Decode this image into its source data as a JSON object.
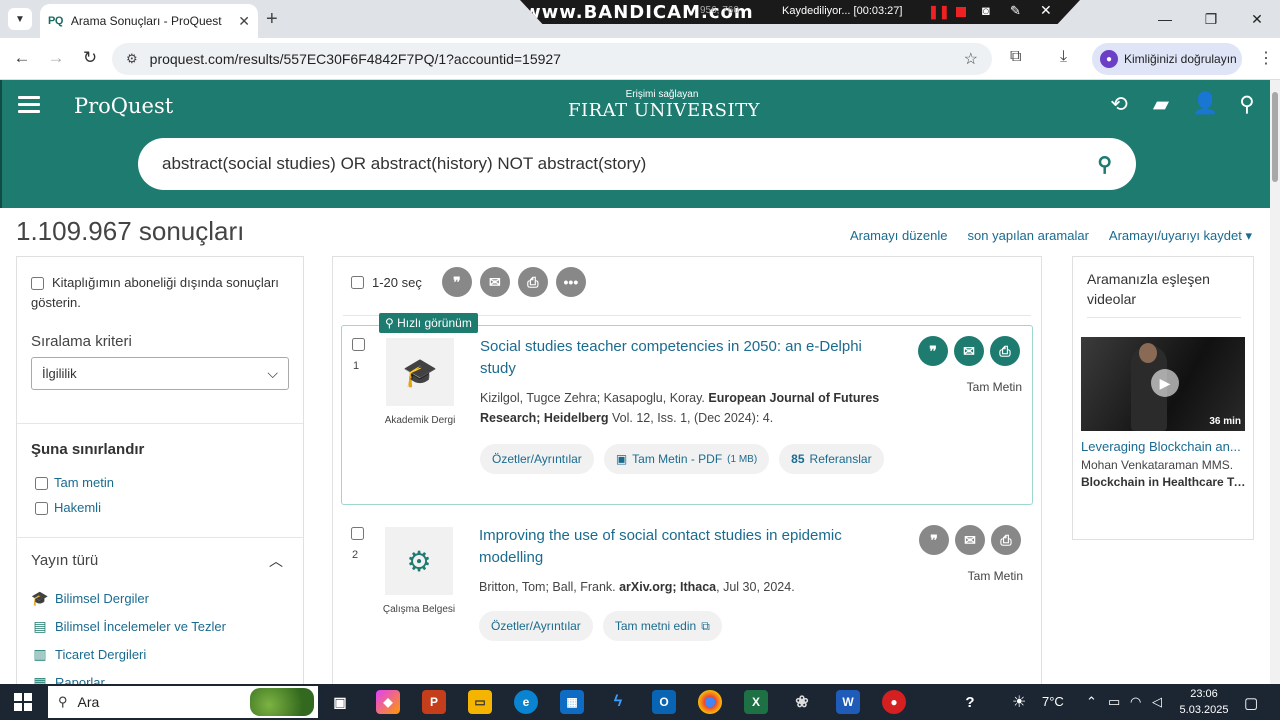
{
  "browser": {
    "tab_favicon": "PQ",
    "tab_title": "Arama Sonuçları - ProQuest",
    "url": "proquest.com/results/557EC30F6F4842F7PQ/1?accountid=15927",
    "verify_label": "Kimliğinizi doğrulayın"
  },
  "recorder": {
    "brand": "www.BANDICAM.com",
    "coords": "956, 760",
    "status": "Kaydediliyor... [00:03:27]"
  },
  "header": {
    "logo": "ProQuest",
    "access_label": "Erişimi sağlayan",
    "university": "FIRAT UNIVERSITY",
    "search_query": "abstract(social studies) OR abstract(history) NOT abstract(story)"
  },
  "results": {
    "count_text": "1.109.967 sonuçları",
    "links": [
      "Aramayı düzenle",
      "son yapılan aramalar",
      "Aramayı/uyarıyı kaydet ▾"
    ]
  },
  "sidebar": {
    "outside_subscription": "Kitaplığımın aboneliği dışında sonuçları gösterin.",
    "sort_label": "Sıralama kriteri",
    "sort_value": "İlgililik",
    "limit_heading": "Şuna sınırlandır",
    "limit_filters": [
      "Tam metin",
      "Hakemli"
    ],
    "pub_type_heading": "Yayın türü",
    "pub_types": [
      "Bilimsel Dergiler",
      "Bilimsel İncelemeler ve Tezler",
      "Ticaret Dergileri",
      "Raporlar"
    ]
  },
  "toolbar": {
    "select_label": "1-20 seç",
    "quick_view": "Hızlı görünüm"
  },
  "items": [
    {
      "num": "1",
      "type": "Akademik Dergi",
      "title": "Social studies teacher competencies in 2050: an e-Delphi study",
      "authors": "Kizilgol, Tugce Zehra; Kasapoglu, Koray.",
      "journal": "European Journal of Futures Research; Heidelberg",
      "details": "Vol. 12, Iss. 1,  (Dec 2024): 4.",
      "btn_abstract": "Özetler/Ayrıntılar",
      "btn_pdf": "Tam Metin - PDF",
      "btn_pdf_size": "(1 MB)",
      "btn_refs_count": "85",
      "btn_refs_label": "Referanslar",
      "fulltext": "Tam Metin"
    },
    {
      "num": "2",
      "type": "Çalışma Belgesi",
      "title": "Improving the use of social contact studies in epidemic modelling",
      "authors": "Britton, Tom; Ball, Frank.",
      "journal": "arXiv.org; Ithaca",
      "details": ", Jul 30, 2024.",
      "btn_abstract": "Özetler/Ayrıntılar",
      "btn_get": "Tam metni edin",
      "fulltext": "Tam Metin"
    }
  ],
  "videos": {
    "heading": "Aramanızla eşleşen videolar",
    "duration": "36 min",
    "title": "Leveraging Blockchain an...",
    "author": "Mohan Venkataraman MMS.",
    "series": "Blockchain in Healthcare To..."
  },
  "taskbar": {
    "search_label": "Ara",
    "temperature": "7°C",
    "time": "23:06",
    "date": "5.03.2025"
  }
}
